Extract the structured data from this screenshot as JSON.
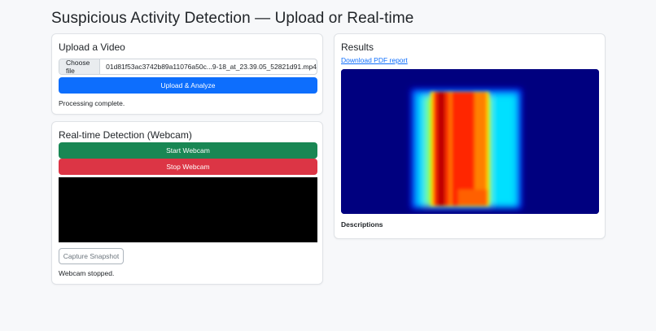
{
  "page": {
    "title": "Suspicious Activity Detection — Upload or Real-time"
  },
  "upload": {
    "title": "Upload a Video",
    "choose_file_label": "Choose file",
    "file_name": "01d81f53ac3742b89a11076a50c...9-18_at_23.39.05_52821d91.mp4",
    "analyze_button": "Upload & Analyze",
    "status": "Processing complete."
  },
  "webcam": {
    "title": "Real-time Detection (Webcam)",
    "start_button": "Start Webcam",
    "stop_button": "Stop Webcam",
    "snapshot_button": "Capture Snapshot",
    "status": "Webcam stopped."
  },
  "results": {
    "title": "Results",
    "pdf_link": "Download PDF report",
    "heatmap_alt": "",
    "descriptions_label": "Descriptions"
  },
  "colors": {
    "primary": "#0d6efd",
    "success": "#198754",
    "danger": "#dc3545",
    "heatmap_background": "#00007f"
  }
}
